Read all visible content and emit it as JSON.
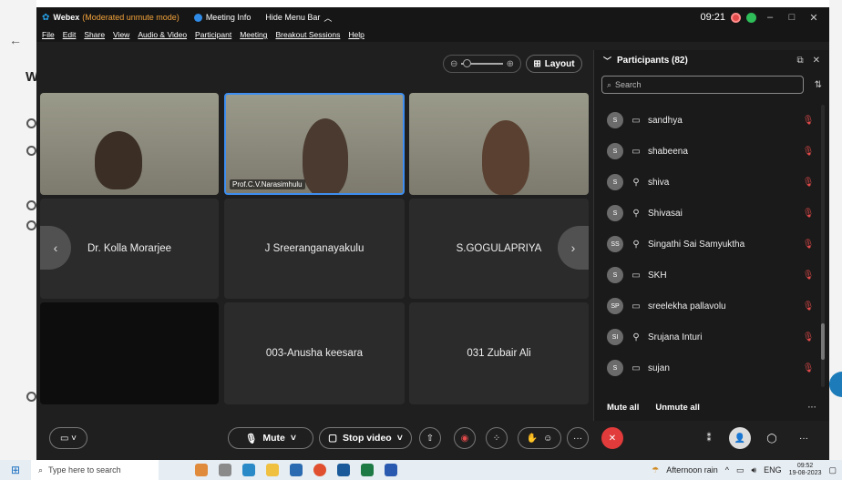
{
  "titlebar": {
    "app": "Webex",
    "mode": "(Moderated unmute mode)",
    "meeting_info": "Meeting Info",
    "hide_menu": "Hide Menu Bar",
    "time": "09:21"
  },
  "menu": [
    "File",
    "Edit",
    "Share",
    "View",
    "Audio & Video",
    "Participant",
    "Meeting",
    "Breakout Sessions",
    "Help"
  ],
  "toolbar": {
    "layout_label": "Layout"
  },
  "tiles": {
    "active_label": "Prof.C.V.Narasimhulu",
    "names": [
      "Dr. Kolla Morarjee",
      "J Sreeranganayakulu",
      "S.GOGULAPRIYA",
      "003-Anusha keesara",
      "031 Zubair Ali"
    ]
  },
  "participants": {
    "title": "Participants (82)",
    "search_placeholder": "Search",
    "list": [
      {
        "initials": "S",
        "name": "sandhya",
        "device": "desktop"
      },
      {
        "initials": "S",
        "name": "shabeena",
        "device": "desktop"
      },
      {
        "initials": "S",
        "name": "shiva",
        "device": "mobile"
      },
      {
        "initials": "S",
        "name": "Shivasai",
        "device": "mobile"
      },
      {
        "initials": "SS",
        "name": "Singathi Sai Samyuktha",
        "device": "mobile"
      },
      {
        "initials": "S",
        "name": "SKH",
        "device": "desktop"
      },
      {
        "initials": "SP",
        "name": "sreelekha pallavolu",
        "device": "desktop"
      },
      {
        "initials": "SI",
        "name": "Srujana Inturi",
        "device": "mobile"
      },
      {
        "initials": "S",
        "name": "sujan",
        "device": "desktop"
      }
    ],
    "mute_all": "Mute all",
    "unmute_all": "Unmute all"
  },
  "controls": {
    "mute": "Mute",
    "stop_video": "Stop video"
  },
  "taskbar": {
    "search_placeholder": "Type here to search",
    "weather": "Afternoon rain",
    "lang": "ENG",
    "time": "09:52",
    "date": "19-08-2023"
  },
  "colors": {
    "accent": "#3d8ef0",
    "end_call": "#e23b3b",
    "mode_text": "#f2a23a",
    "muted": "#e34a4a"
  }
}
